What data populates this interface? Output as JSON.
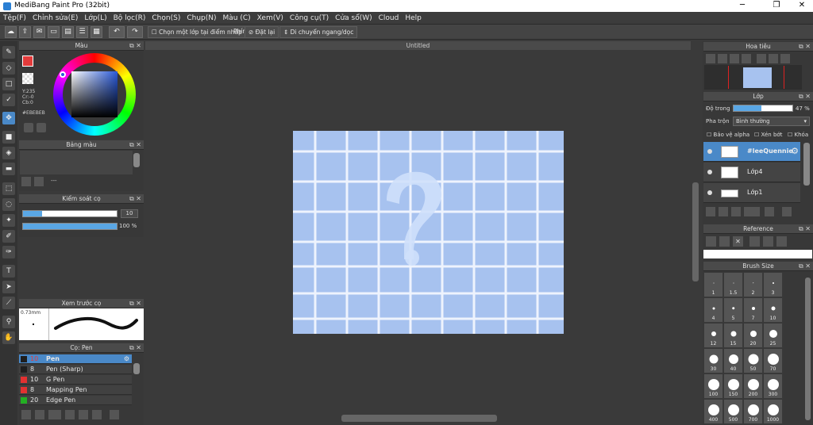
{
  "window": {
    "title": "MediBang Paint Pro (32bit)",
    "minimize": "─",
    "maximize": "❐",
    "close": "✕"
  },
  "menu": [
    "Tệp(F)",
    "Chỉnh sửa(E)",
    "Lớp(L)",
    "Bộ lọc(R)",
    "Chọn(S)",
    "Chụp(N)",
    "Màu (C)",
    "Xem(V)",
    "Công cụ(T)",
    "Cửa sổ(W)",
    "Cloud",
    "Help"
  ],
  "toolbar": {
    "select_layer_label": "Chọn một lớp tại điểm nhấp",
    "keyboard_label": "Phím",
    "reset_label": "Đặt lại",
    "move_label": "Di chuyển ngang/dọc"
  },
  "color_panel": {
    "title": "Màu",
    "hex": "#EBEBEB",
    "values": [
      "Y:235",
      "Cr:-0",
      "Cb:0"
    ],
    "accent": "#e33b3b"
  },
  "palette_panel": {
    "title": "Bảng màu",
    "more": "---"
  },
  "brush_control": {
    "title": "Kiểm soát cọ",
    "size_value": "10",
    "opacity_value": "100 %",
    "size_fraction": 0.2,
    "opacity_fraction": 1.0
  },
  "preview_panel": {
    "title": "Xem trước cọ",
    "size": "0.73mm"
  },
  "brush_panel": {
    "title": "Cọ: Pen",
    "items": [
      {
        "size": "10",
        "name": "Pen",
        "color": "#1e1e1e",
        "selected": true
      },
      {
        "size": "8",
        "name": "Pen (Sharp)",
        "color": "#1e1e1e",
        "selected": false
      },
      {
        "size": "10",
        "name": "G Pen",
        "color": "#e23131",
        "selected": false
      },
      {
        "size": "8",
        "name": "Mapping Pen",
        "color": "#e23131",
        "selected": false
      },
      {
        "size": "20",
        "name": "Edge Pen",
        "color": "#23b023",
        "selected": false
      }
    ]
  },
  "canvas": {
    "tab_title": "Untitled",
    "doc_color": "#a7c2ef"
  },
  "navigator": {
    "title": "Hoa tiêu"
  },
  "layer_panel": {
    "title": "Lớp",
    "opacity_label": "Độ trong",
    "opacity_value": "47 %",
    "opacity_fraction": 0.47,
    "blend_label": "Pha trộn",
    "blend_value": "Bình thường",
    "protect_alpha": "Bảo vệ alpha",
    "clipping": "Xén bớt",
    "lock": "Khóa",
    "layers": [
      {
        "name": "#leeQuennie",
        "selected": true
      },
      {
        "name": "Lớp4",
        "selected": false
      },
      {
        "name": "Lớp1",
        "selected": false
      }
    ]
  },
  "reference_panel": {
    "title": "Reference"
  },
  "brush_size_panel": {
    "title": "Brush Size",
    "sizes": [
      "1",
      "1.5",
      "2",
      "3",
      "4",
      "5",
      "7",
      "10",
      "12",
      "15",
      "20",
      "25",
      "30",
      "40",
      "50",
      "70",
      "100",
      "150",
      "200",
      "300",
      "400",
      "500",
      "700",
      "1000"
    ]
  }
}
